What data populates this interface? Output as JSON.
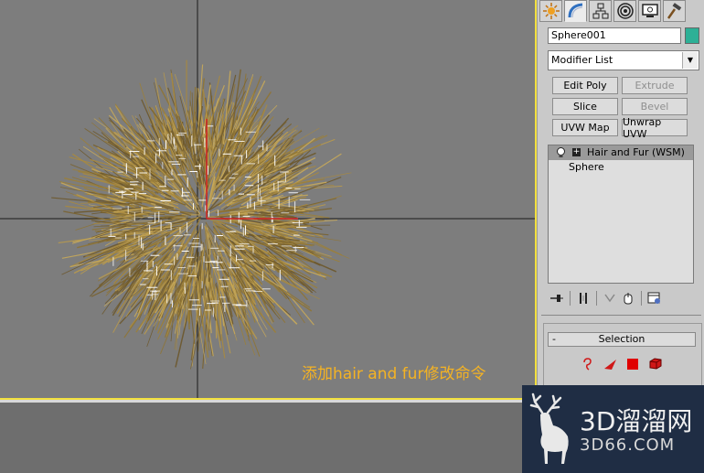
{
  "viewport": {
    "caption": "添加hair and fur修改命令",
    "accent_color": "#f2e040",
    "caption_color": "#f5b323",
    "fur_color": "#9a7f3a"
  },
  "command_panel": {
    "tabs": [
      {
        "name": "create-tab",
        "icon": "sun-star-icon"
      },
      {
        "name": "modify-tab",
        "icon": "bent-curve-icon"
      },
      {
        "name": "hierarchy-tab",
        "icon": "hierarchy-icon"
      },
      {
        "name": "motion-tab",
        "icon": "motion-circle-icon"
      },
      {
        "name": "display-tab",
        "icon": "monitor-icon"
      },
      {
        "name": "utilities-tab",
        "icon": "hammer-icon"
      }
    ],
    "object_name": "Sphere001",
    "object_color": "#2db096",
    "modifier_list": "Modifier List",
    "buttons": [
      {
        "label": "Edit Poly",
        "enabled": true
      },
      {
        "label": "Extrude",
        "enabled": false
      },
      {
        "label": "Slice",
        "enabled": true
      },
      {
        "label": "Bevel",
        "enabled": false
      },
      {
        "label": "UVW Map",
        "enabled": true
      },
      {
        "label": "Unwrap UVW",
        "enabled": true
      }
    ],
    "stack": [
      {
        "label": "Hair and Fur (WSM)",
        "selected": true
      },
      {
        "label": "Sphere",
        "selected": false
      }
    ],
    "rollout": {
      "minus": "-",
      "title": "Selection"
    }
  },
  "watermark": {
    "line1": "3D溜溜网",
    "line2": "3D66.COM"
  }
}
